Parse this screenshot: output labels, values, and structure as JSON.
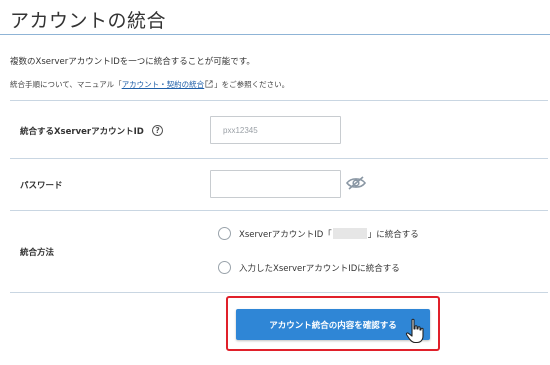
{
  "page": {
    "title": "アカウントの統合",
    "intro": "複数のXserverアカウントIDを一つに統合することが可能です。",
    "manual": {
      "prefix": "統合手順について、マニュアル「",
      "link_label": "アカウント・契約の統合",
      "suffix": "」をご参照ください。"
    }
  },
  "form": {
    "account_id": {
      "label": "統合するXserverアカウントID",
      "help_icon": "question-circle-icon",
      "placeholder": "pxx12345",
      "value": ""
    },
    "password": {
      "label": "パスワード",
      "value": "",
      "toggle_icon": "eye-slash-icon"
    },
    "method": {
      "label": "統合方法",
      "options": [
        {
          "prefix": "XserverアカウントID「",
          "suffix": "」に統合する",
          "selected": false
        },
        {
          "label": "入力したXserverアカウントIDに統合する",
          "selected": false
        }
      ]
    }
  },
  "actions": {
    "confirm_label": "アカウント統合の内容を確認する"
  },
  "colors": {
    "accent": "#2f86d6",
    "highlight": "#e0202a",
    "link": "#1f5fa8",
    "divider": "#c9d6e2"
  }
}
